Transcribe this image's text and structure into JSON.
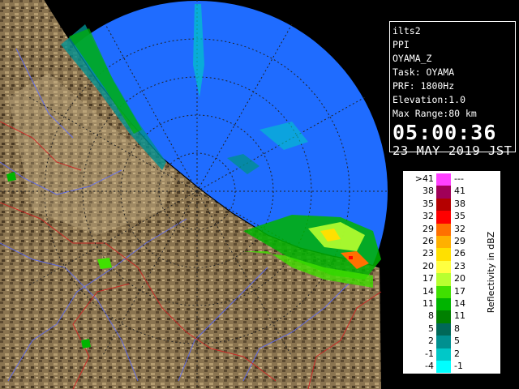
{
  "info": {
    "lines": [
      "ilts2",
      "PPI",
      "OYAMA_Z",
      "Task: OYAMA",
      "PRF: 1800Hz",
      "Elevation:1.0",
      "Max Range:80 km"
    ],
    "time": "05:00:36",
    "date": "23 MAY 2019 JST"
  },
  "legend": {
    "title": "Reflectivity in dBZ",
    "rows": [
      {
        "lo": ">41",
        "hi": "---",
        "color": "#ff40ff"
      },
      {
        "lo": "38",
        "hi": "41",
        "color": "#a00058"
      },
      {
        "lo": "35",
        "hi": "38",
        "color": "#b40000"
      },
      {
        "lo": "32",
        "hi": "35",
        "color": "#ff0000"
      },
      {
        "lo": "29",
        "hi": "32",
        "color": "#ff7000"
      },
      {
        "lo": "26",
        "hi": "29",
        "color": "#ffb000"
      },
      {
        "lo": "23",
        "hi": "26",
        "color": "#ffe000"
      },
      {
        "lo": "20",
        "hi": "23",
        "color": "#ffff40"
      },
      {
        "lo": "17",
        "hi": "20",
        "color": "#b8ff30"
      },
      {
        "lo": "14",
        "hi": "17",
        "color": "#40e000"
      },
      {
        "lo": "11",
        "hi": "14",
        "color": "#00b400"
      },
      {
        "lo": "8",
        "hi": "11",
        "color": "#008000"
      },
      {
        "lo": "5",
        "hi": "8",
        "color": "#006858"
      },
      {
        "lo": "2",
        "hi": "5",
        "color": "#009090"
      },
      {
        "lo": "-1",
        "hi": "2",
        "color": "#00c8c8"
      },
      {
        "lo": "-4",
        "hi": "-1",
        "color": "#00ffff"
      }
    ]
  },
  "colors": {
    "sea": "#1f6cff",
    "land": "#8a7450",
    "range_ring": "#222222"
  }
}
